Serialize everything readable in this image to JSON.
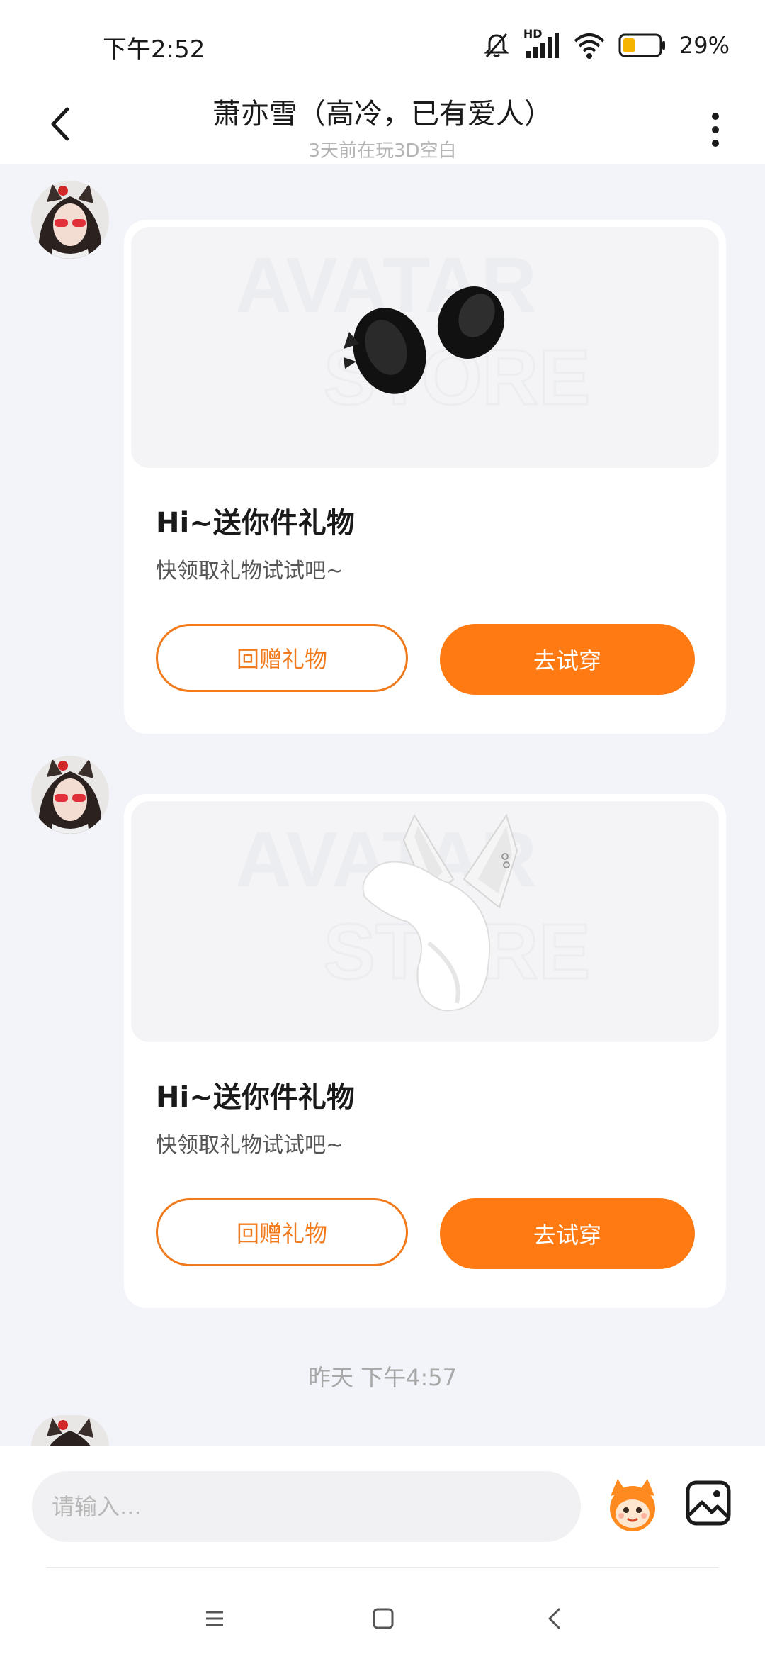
{
  "status_bar": {
    "time": "下午2:52",
    "network": "HD",
    "battery_percent": "29%",
    "icons": [
      "mute-icon",
      "signal-icon",
      "wifi-icon",
      "battery-icon"
    ]
  },
  "header": {
    "title": "萧亦雪（高冷，已有爱人）",
    "subtitle": "3天前在玩3D空白",
    "back_icon": "chevron-left-icon",
    "more_icon": "more-vertical-icon"
  },
  "messages": [
    {
      "type": "gift-card",
      "watermark": [
        "AVATAR",
        "STORE"
      ],
      "title": "Hi~送你件礼物",
      "description": "快领取礼物试试吧~",
      "return_button": "回赠礼物",
      "try_button": "去试穿",
      "item_icon": "black-fur-ears-image"
    },
    {
      "type": "gift-card",
      "watermark": [
        "AVATAR",
        "STORE"
      ],
      "title": "Hi~送你件礼物",
      "description": "快领取礼物试试吧~",
      "return_button": "回赠礼物",
      "try_button": "去试穿",
      "item_icon": "white-fox-ears-tail-image"
    }
  ],
  "timestamp": "昨天 下午4:57",
  "input": {
    "placeholder": "请输入..."
  },
  "colors": {
    "accent": "#ff7a12",
    "page_bg": "#f2f4f9",
    "card_bg": "#ffffff"
  }
}
